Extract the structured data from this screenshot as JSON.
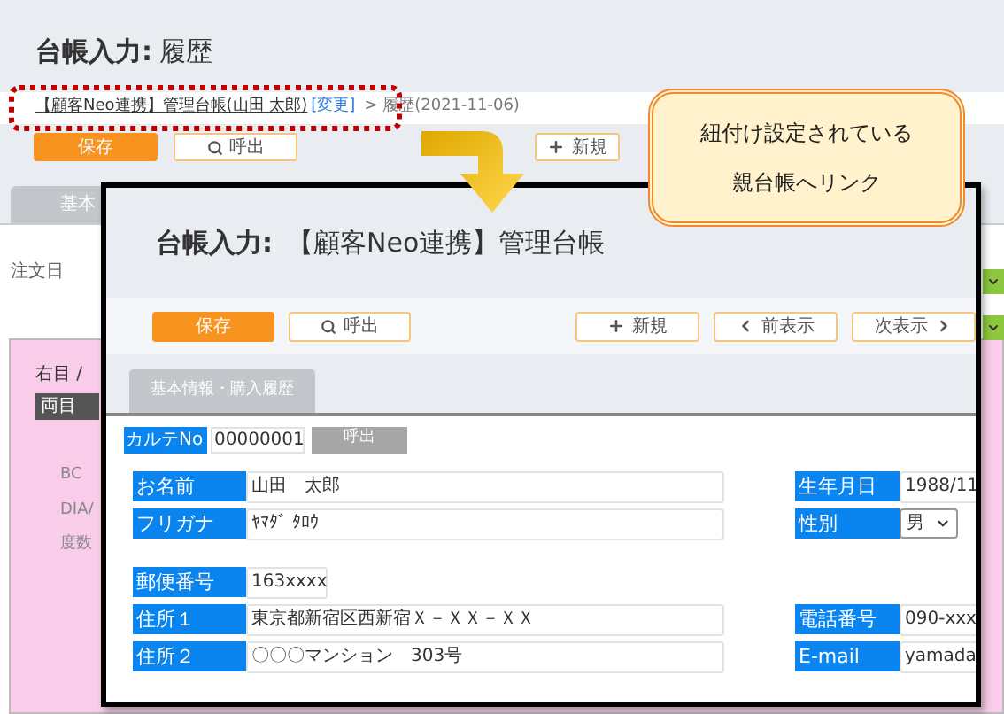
{
  "page": {
    "title_label": "台帳入力:",
    "title_value": "履歴",
    "breadcrumb": {
      "link": "【顧客Neo連携】管理台帳(山田 太郎)",
      "change": "[変更]",
      "current": "> 履歴(2021-11-06)"
    },
    "buttons": [
      {
        "label": "保存",
        "kind": "primary"
      },
      {
        "label": "呼出",
        "kind": "search"
      },
      {
        "label": "新規",
        "kind": "plus"
      }
    ],
    "tabs": [
      {
        "label": "基本",
        "selected": false
      }
    ],
    "field_label": "注文日",
    "panel": {
      "label": "右目 /",
      "badge": "両目",
      "rows": [
        "BC",
        "DIA/",
        "度数"
      ]
    }
  },
  "inset": {
    "title_label": "台帳入力:",
    "title_value": "【顧客Neo連携】管理台帳",
    "buttons": [
      {
        "label": "保存",
        "kind": "primary"
      },
      {
        "label": "呼出",
        "kind": "search"
      },
      {
        "label": "新規",
        "kind": "plus"
      },
      {
        "label": "前表示",
        "kind": "prev"
      },
      {
        "label": "次表示",
        "kind": "next"
      }
    ],
    "tabs": [
      {
        "label": "基本情報・購入履歴",
        "selected": true
      }
    ],
    "karte": {
      "label": "カルテNo",
      "value": "00000001",
      "button": "呼出"
    },
    "rows": [
      {
        "left": {
          "label": "お名前",
          "value": "山田　太郎",
          "kind": "input"
        },
        "right": {
          "label": "生年月日",
          "value": "1988/11",
          "kind": "input"
        }
      },
      {
        "left": {
          "label": "フリガナ",
          "value": "ﾔﾏﾀﾞ ﾀﾛｳ",
          "kind": "input"
        },
        "right": {
          "label": "性別",
          "value": "男",
          "kind": "select"
        }
      },
      {
        "left": {
          "label": "郵便番号",
          "value": "163xxxx",
          "kind": "short"
        }
      },
      {
        "left": {
          "label": "住所１",
          "value": "東京都新宿区西新宿Ｘ－ＸＸ－ＸＸ",
          "kind": "input"
        },
        "right": {
          "label": "電話番号",
          "value": "090-xxx",
          "kind": "input"
        }
      },
      {
        "left": {
          "label": "住所２",
          "value": "〇〇〇マンション　303号",
          "kind": "input"
        },
        "right": {
          "label": "E-mail",
          "value": "yamada",
          "kind": "input"
        }
      }
    ]
  },
  "callout": {
    "lines": [
      "紐付け設定されている",
      "親台帳へリンク"
    ]
  }
}
